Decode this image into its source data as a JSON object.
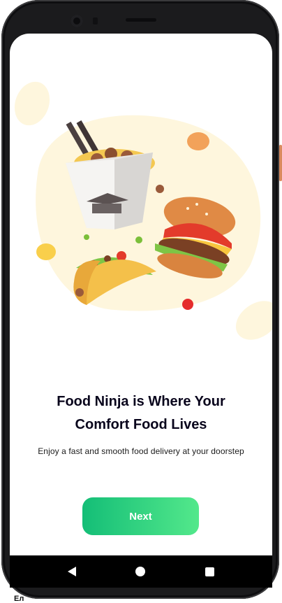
{
  "onboarding": {
    "headline_line1": "Food Ninja is Where Your",
    "headline_line2": "Comfort Food Lives",
    "subtitle": "Enjoy a fast and smooth food delivery at your doorstep",
    "next_label": "Next"
  },
  "navbar": {
    "back_icon": "back-triangle-icon",
    "home_icon": "home-circle-icon",
    "recent_icon": "recent-square-icon"
  },
  "bottom_label": "Ел",
  "colors": {
    "accent_start": "#14be77",
    "accent_end": "#53e88b",
    "blob": "#fef6dd",
    "headline": "#09051c"
  }
}
